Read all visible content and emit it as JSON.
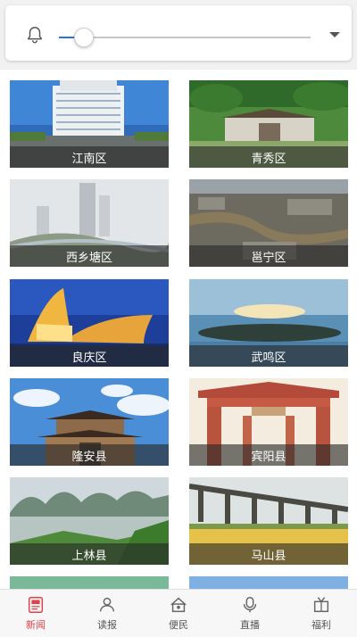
{
  "volume": {
    "level": 0.1
  },
  "tiles": [
    {
      "label": "江南区",
      "scene": "building"
    },
    {
      "label": "青秀区",
      "scene": "temple-garden"
    },
    {
      "label": "西乡塘区",
      "scene": "city-haze"
    },
    {
      "label": "邕宁区",
      "scene": "river-aerial"
    },
    {
      "label": "良庆区",
      "scene": "lit-building"
    },
    {
      "label": "武鸣区",
      "scene": "sunset-river"
    },
    {
      "label": "隆安县",
      "scene": "gate-sky"
    },
    {
      "label": "宾阳县",
      "scene": "red-gate"
    },
    {
      "label": "上林县",
      "scene": "karst-lake"
    },
    {
      "label": "马山县",
      "scene": "bridge-field"
    },
    {
      "label": "",
      "scene": "partial-green"
    },
    {
      "label": "",
      "scene": "partial-blue"
    }
  ],
  "nav": [
    {
      "label": "新闻",
      "icon": "news-icon",
      "active": true
    },
    {
      "label": "读报",
      "icon": "reader-icon",
      "active": false
    },
    {
      "label": "便民",
      "icon": "service-icon",
      "active": false
    },
    {
      "label": "直播",
      "icon": "live-icon",
      "active": false
    },
    {
      "label": "福利",
      "icon": "gift-icon",
      "active": false
    }
  ],
  "colors": {
    "accent": "#e0424b",
    "slider": "#2a73d9"
  }
}
